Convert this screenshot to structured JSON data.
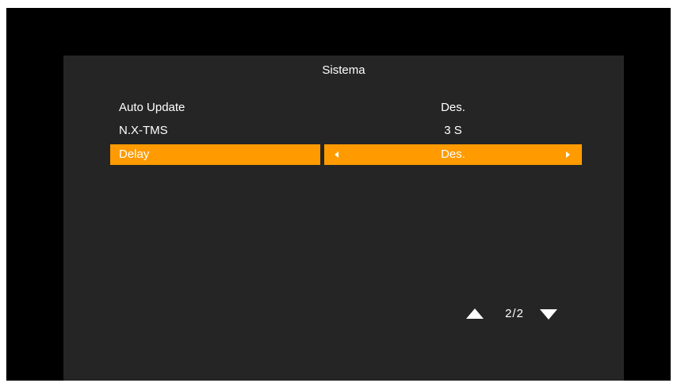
{
  "menu": {
    "title": "Sistema",
    "items": [
      {
        "label": "Auto Update",
        "value": "Des."
      },
      {
        "label": "N.X-TMS",
        "value": "3 S"
      },
      {
        "label": "Delay",
        "value": "Des.",
        "selected": true
      }
    ]
  },
  "pager": {
    "text": "2/2"
  },
  "colors": {
    "highlight": "#ff9b00",
    "panel": "#252525",
    "background": "#000000",
    "text": "#ffffff"
  },
  "icons": {
    "page_up": "triangle-up-icon",
    "page_down": "triangle-down-icon",
    "value_prev": "arrow-left-icon",
    "value_next": "arrow-right-icon"
  }
}
